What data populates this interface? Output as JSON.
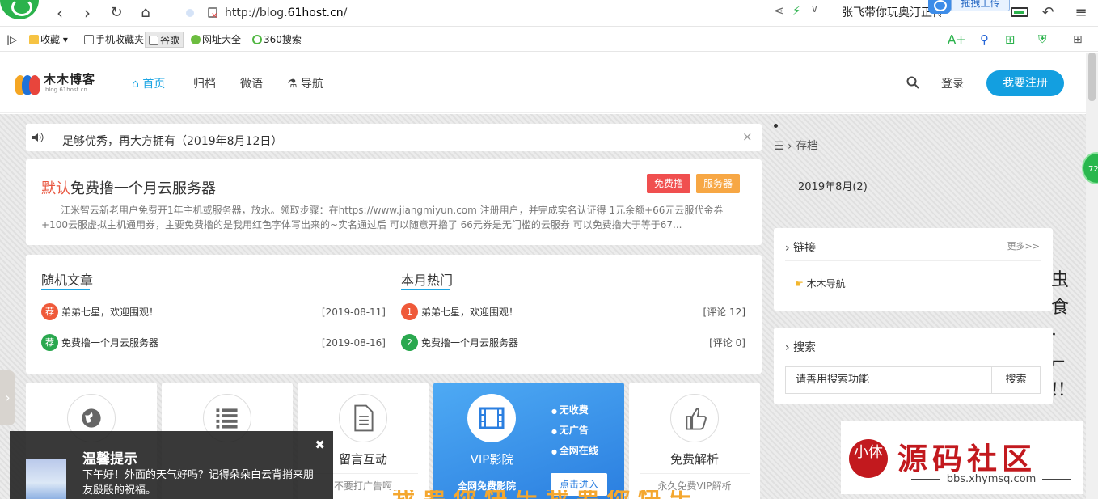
{
  "browser": {
    "url_prefix": "http://blog.",
    "url_host": "61host.cn",
    "url_suffix": "/",
    "tab_title": "张飞带你玩奥汀正传",
    "upload_label": "拖拽上传"
  },
  "bookmarks": [
    {
      "label": "收藏"
    },
    {
      "label": "手机收藏夹"
    },
    {
      "label": "谷歌"
    },
    {
      "label": "网址大全"
    },
    {
      "label": "360搜索"
    }
  ],
  "site": {
    "logo_name": "木木博客",
    "logo_sub": "blog.61host.cn",
    "menu": [
      "首页",
      "归档",
      "微语",
      "导航"
    ],
    "login": "登录",
    "register": "我要注册"
  },
  "notice": {
    "text": "足够优秀，再大方拥有（2019年8月12日）",
    "close": "×"
  },
  "post": {
    "category": "默认",
    "title": "免费撸一个月云服务器",
    "tags": [
      "免费撸",
      "服务器"
    ],
    "excerpt": "江米智云新老用户免费开1年主机或服务器，放水。领取步骤：在https://www.jiangmiyun.com 注册用户，并完成实名认证得 1元余额+66元云服代金券+100云服虚拟主机通用券，主要免费撸的是我用红色字体写出来的~实名通过后 可以随意开撸了 66元券是无门槛的云服券 可以免费撸大于等于67..."
  },
  "random": {
    "title": "随机文章",
    "items": [
      {
        "badge": "荐",
        "title": "弟弟七星，欢迎围观！",
        "meta": "[2019-08-11]"
      },
      {
        "badge": "荐",
        "title": "免费撸一个月云服务器",
        "meta": "[2019-08-16]"
      }
    ]
  },
  "hot": {
    "title": "本月热门",
    "items": [
      {
        "badge": "1",
        "title": "弟弟七星，欢迎围观！",
        "meta": "[评论 12]"
      },
      {
        "badge": "2",
        "title": "免费撸一个月云服务器",
        "meta": "[评论 0]"
      }
    ]
  },
  "features": [
    {
      "name": "",
      "desc": ""
    },
    {
      "name": "",
      "desc": ""
    },
    {
      "name": "留言互动",
      "desc": "不要打广告啊"
    },
    {
      "name": "VIP影院",
      "desc": "全网免费影院",
      "bullets": [
        "无收费",
        "无广告",
        "全网在线"
      ],
      "button": "点击进入"
    },
    {
      "name": "免费解析",
      "desc": "永久免费VIP解析"
    }
  ],
  "sidebar": {
    "archive_title": "存档",
    "archive_item": "2019年8月(2)",
    "links_title": "链接",
    "links_more": "更多>>",
    "links_item": "木木导航",
    "search_title": "搜索",
    "search_placeholder": "请善用搜索功能",
    "search_button": "搜索"
  },
  "toast": {
    "title": "温馨提示",
    "message": "下午好！外面的天气好吗？记得朵朵白云背捎来朋友殷殷的祝福。"
  },
  "watermark": {
    "seal": "小体",
    "text": "源码社区",
    "url": "bbs.xhymsq.com"
  },
  "misc": {
    "badge_number": "72",
    "cartoon_text": "虫食"
  },
  "colors": {
    "accent": "#1ca5e3",
    "register": "#139fe0",
    "tag_red": "#f04f4f",
    "tag_orange": "#f7a744",
    "badge_red": "#ef5a3a",
    "badge_green": "#2aa84f"
  }
}
